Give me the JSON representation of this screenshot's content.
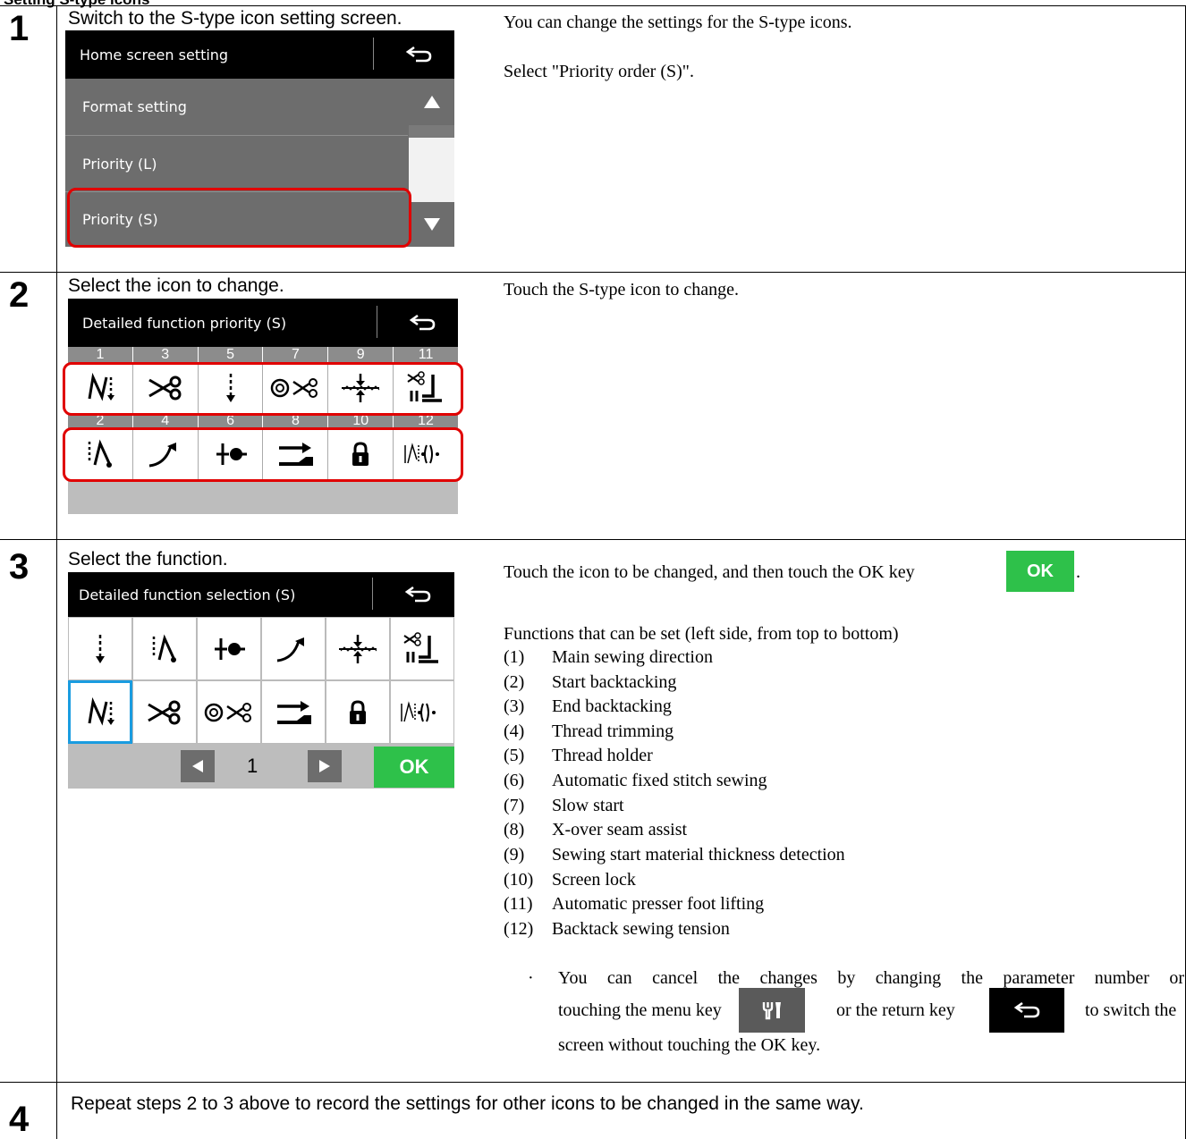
{
  "section_title": "Setting S-type icons",
  "steps": [
    {
      "number": "1",
      "title": "Switch to the S-type icon setting screen.",
      "desc": [
        "You can change the settings for the S-type icons.",
        "Select \"Priority order (S)\"."
      ],
      "screen": {
        "title": "Home screen setting",
        "items": [
          "Format setting",
          "Priority (L)",
          "Priority (S)"
        ]
      }
    },
    {
      "number": "2",
      "title": "Select the icon to change.",
      "desc": [
        "Touch the S-type icon to change."
      ],
      "screen": {
        "title": "Detailed function priority (S)",
        "top_numbers": [
          "1",
          "3",
          "5",
          "7",
          "9",
          "11"
        ],
        "bottom_numbers": [
          "2",
          "4",
          "6",
          "8",
          "10",
          "12"
        ],
        "top_icons": [
          "main-direction-icon",
          "thread-trim-icon",
          "slow-start-icon",
          "thread-holder-trim-icon",
          "material-thickness-icon",
          "presser-foot-icon"
        ],
        "bottom_icons": [
          "start-backtack-icon",
          "end-backtack-icon",
          "auto-fixed-stitch-icon",
          "x-over-assist-icon",
          "lock-icon",
          "backtack-tension-icon"
        ]
      }
    },
    {
      "number": "3",
      "title": "Select the function.",
      "desc_ok": "Touch the icon to be changed, and then touch the OK key",
      "ok_key": "OK",
      "ok_period": ".",
      "functions_heading": "Functions that can be set (left side, from top to bottom)",
      "functions": [
        {
          "num": "(1)",
          "label": "Main sewing direction"
        },
        {
          "num": "(2)",
          "label": "Start backtacking"
        },
        {
          "num": "(3)",
          "label": "End backtacking"
        },
        {
          "num": "(4)",
          "label": "Thread trimming"
        },
        {
          "num": "(5)",
          "label": "Thread holder"
        },
        {
          "num": "(6)",
          "label": "Automatic fixed stitch sewing"
        },
        {
          "num": "(7)",
          "label": "Slow start"
        },
        {
          "num": "(8)",
          "label": "X-over seam assist"
        },
        {
          "num": "(9)",
          "label": "Sewing start material thickness detection"
        },
        {
          "num": "(10)",
          "label": "Screen lock"
        },
        {
          "num": "(11)",
          "label": "Automatic presser foot lifting"
        },
        {
          "num": "(12)",
          "label": "Backtack sewing tension"
        }
      ],
      "note_bullet": "·",
      "note_line1": "You can cancel the changes by changing the parameter number or",
      "note_line2a": "touching the menu key",
      "note_line2b": "or the return key",
      "note_line2c": "to switch the",
      "note_line3": "screen without touching the OK key.",
      "screen": {
        "title": "Detailed function selection (S)",
        "page": "1",
        "ok": "OK"
      }
    },
    {
      "number": "4",
      "title": "Repeat steps 2 to 3 above to record the settings for other icons to be changed in the same way."
    }
  ]
}
